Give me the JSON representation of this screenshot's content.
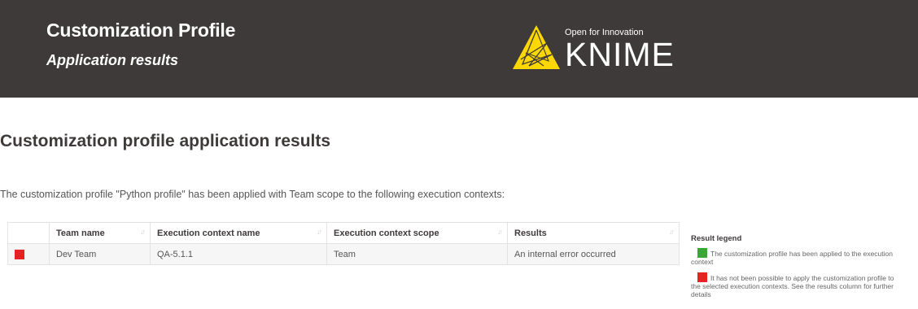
{
  "header": {
    "title": "Customization Profile",
    "subtitle": "Application results",
    "logo": {
      "tagline": "Open for Innovation",
      "wordmark": "KNIME"
    }
  },
  "main": {
    "heading": "Customization profile application results",
    "description": "The customization profile \"Python profile\" has been applied with Team scope to the following execution contexts:",
    "table": {
      "columns": [
        "",
        "Team name",
        "Execution context name",
        "Execution context scope",
        "Results"
      ],
      "rows": [
        {
          "status": "error",
          "team_name": "Dev Team",
          "context_name": "QA-5.1.1",
          "context_scope": "Team",
          "result": "An internal error occurred"
        }
      ]
    }
  },
  "legend": {
    "title": "Result legend",
    "items": [
      {
        "status": "success",
        "text": "The customization profile has been applied to the execution context"
      },
      {
        "status": "error",
        "text": "It has not been possible to apply the customization profile to the selected execution contexts. See the results column for further details"
      }
    ]
  },
  "colors": {
    "header_bg": "#3e3a39",
    "logo_yellow": "#fdd800",
    "success": "#3aa63a",
    "error": "#e52325"
  }
}
